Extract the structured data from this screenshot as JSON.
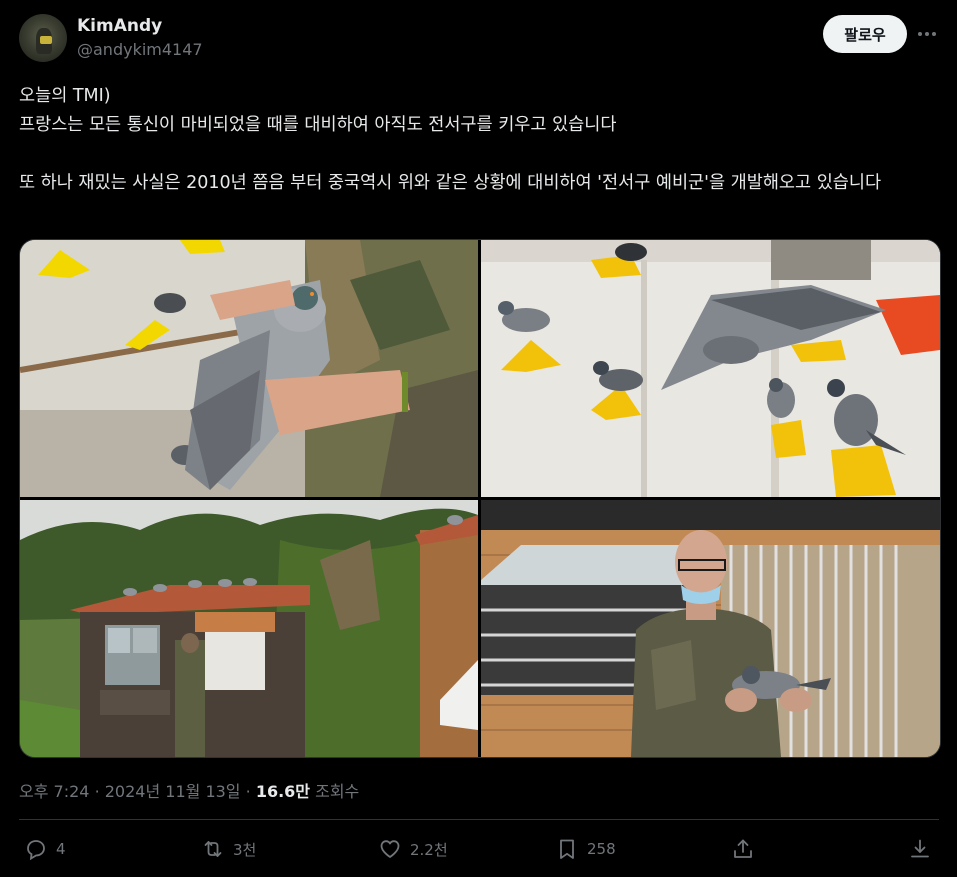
{
  "author": {
    "name": "KimAndy",
    "handle": "@andykim4147"
  },
  "follow_label": "팔로우",
  "more_icon": "more-horizontal-icon",
  "text": "오늘의 TMI)\n프랑스는 모든 통신이 마비되었을 때를 대비하여 아직도 전서구를 키우고 있습니다\n\n또 하나 재밌는 사실은 2010년 쯤음 부터 중국역시 위와 같은 상황에 대비하여 '전서구 예비군'을 개발해오고 있습니다",
  "meta": {
    "time": "오후 7:24",
    "separator": "·",
    "date": "2024년 11월 13일",
    "views_count": "16.6만",
    "views_label": "조회수"
  },
  "actions": {
    "reply": {
      "icon": "reply-icon",
      "count": "4"
    },
    "retweet": {
      "icon": "retweet-icon",
      "count": "3천"
    },
    "like": {
      "icon": "heart-icon",
      "count": "2.2천"
    },
    "bookmark": {
      "icon": "bookmark-icon",
      "count": "258"
    },
    "share": {
      "icon": "share-icon"
    },
    "download": {
      "icon": "download-icon"
    }
  },
  "colors": {
    "background": "#000000",
    "text": "#e7e9ea",
    "secondary": "#71767b",
    "follow_bg": "#eff3f4",
    "border": "#2f3336"
  }
}
